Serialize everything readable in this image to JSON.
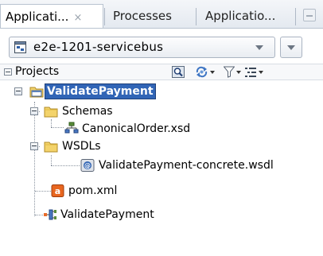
{
  "tabs": [
    {
      "label": "Applicati...",
      "close": "×",
      "active": true
    },
    {
      "label": "Processes",
      "active": false
    },
    {
      "label": "Applicatio...",
      "active": false
    }
  ],
  "selector": {
    "value": "e2e-1201-servicebus"
  },
  "projects_panel": {
    "title": "Projects"
  },
  "tree": {
    "root": "ValidatePayment",
    "schemas_folder": "Schemas",
    "schema_file": "CanonicalOrder.xsd",
    "wsdls_folder": "WSDLs",
    "wsdl_file": "ValidatePayment-concrete.wsdl",
    "pom_file": "pom.xml",
    "composite": "ValidatePayment"
  },
  "colors": {
    "selection": "#3165b6",
    "folder": "#f3d36b",
    "maven": "#e8661f"
  },
  "icons": [
    "application-icon",
    "folder-icon",
    "schema-icon",
    "wsdl-icon",
    "maven-icon",
    "composite-icon",
    "find-icon",
    "sync-icon",
    "filter-icon",
    "options-icon"
  ]
}
